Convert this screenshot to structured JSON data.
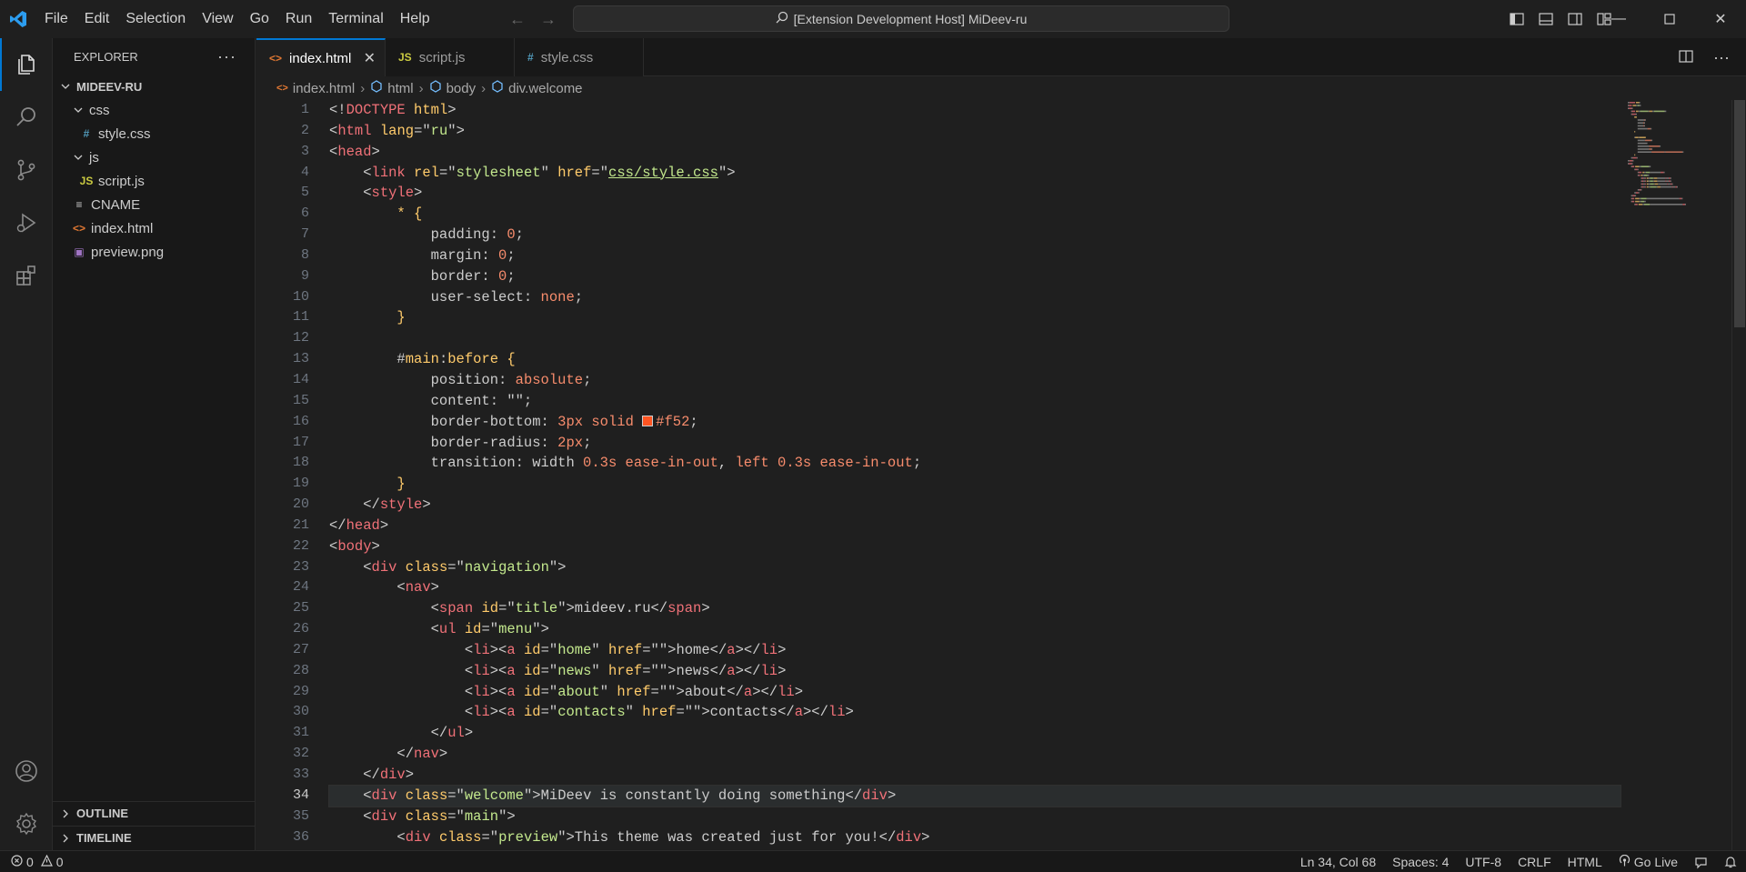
{
  "titlebar": {
    "menu": [
      "File",
      "Edit",
      "Selection",
      "View",
      "Go",
      "Run",
      "Terminal",
      "Help"
    ],
    "command_center": "[Extension Development Host] MiDeev-ru"
  },
  "sidebar": {
    "title": "EXPLORER",
    "root": "MIDEEV-RU",
    "tree": [
      {
        "label": "css",
        "type": "folder",
        "depth": 1
      },
      {
        "label": "style.css",
        "type": "css",
        "depth": 2
      },
      {
        "label": "js",
        "type": "folder",
        "depth": 1
      },
      {
        "label": "script.js",
        "type": "js",
        "depth": 2
      },
      {
        "label": "CNAME",
        "type": "text",
        "depth": 1
      },
      {
        "label": "index.html",
        "type": "html",
        "depth": 1
      },
      {
        "label": "preview.png",
        "type": "image",
        "depth": 1
      }
    ],
    "outline": "OUTLINE",
    "timeline": "TIMELINE"
  },
  "tabs": [
    {
      "label": "index.html",
      "icon": "html",
      "active": true
    },
    {
      "label": "script.js",
      "icon": "js",
      "active": false
    },
    {
      "label": "style.css",
      "icon": "css",
      "active": false
    }
  ],
  "breadcrumbs": [
    "index.html",
    "html",
    "body",
    "div.welcome"
  ],
  "editor": {
    "current_line": 34,
    "lines": [
      [
        [
          "p",
          "<!"
        ],
        [
          "tag",
          "DOCTYPE"
        ],
        [
          "p",
          " "
        ],
        [
          "attr",
          "html"
        ],
        [
          "p",
          ">"
        ]
      ],
      [
        [
          "p",
          "<"
        ],
        [
          "tag",
          "html"
        ],
        [
          "p",
          " "
        ],
        [
          "attr",
          "lang"
        ],
        [
          "p",
          "=\""
        ],
        [
          "str",
          "ru"
        ],
        [
          "p",
          "\">"
        ]
      ],
      [
        [
          "p",
          "<"
        ],
        [
          "tag",
          "head"
        ],
        [
          "p",
          ">"
        ]
      ],
      [
        [
          "p",
          "    <"
        ],
        [
          "tag",
          "link"
        ],
        [
          "p",
          " "
        ],
        [
          "attr",
          "rel"
        ],
        [
          "p",
          "=\""
        ],
        [
          "str",
          "stylesheet"
        ],
        [
          "p",
          "\" "
        ],
        [
          "attr",
          "href"
        ],
        [
          "p",
          "=\""
        ],
        [
          "link",
          "css/style.css"
        ],
        [
          "p",
          "\">"
        ]
      ],
      [
        [
          "p",
          "    <"
        ],
        [
          "tag",
          "style"
        ],
        [
          "p",
          ">"
        ]
      ],
      [
        [
          "p",
          "        "
        ],
        [
          "sel",
          "* {"
        ]
      ],
      [
        [
          "p",
          "            padding: "
        ],
        [
          "num",
          "0"
        ],
        [
          "p",
          ";"
        ]
      ],
      [
        [
          "p",
          "            margin: "
        ],
        [
          "num",
          "0"
        ],
        [
          "p",
          ";"
        ]
      ],
      [
        [
          "p",
          "            border: "
        ],
        [
          "num",
          "0"
        ],
        [
          "p",
          ";"
        ]
      ],
      [
        [
          "p",
          "            user-select: "
        ],
        [
          "num",
          "none"
        ],
        [
          "p",
          ";"
        ]
      ],
      [
        [
          "p",
          "        "
        ],
        [
          "sel",
          "}"
        ]
      ],
      [
        [
          "p",
          ""
        ]
      ],
      [
        [
          "p",
          "        #"
        ],
        [
          "sel",
          "main"
        ],
        [
          "p",
          ":"
        ],
        [
          "sel",
          "before {"
        ]
      ],
      [
        [
          "p",
          "            position: "
        ],
        [
          "num",
          "absolute"
        ],
        [
          "p",
          ";"
        ]
      ],
      [
        [
          "p",
          "            content: \"\";"
        ]
      ],
      [
        [
          "p",
          "            border-bottom: "
        ],
        [
          "num",
          "3px solid "
        ],
        [
          "swatch",
          "#f52"
        ],
        [
          "p",
          ";"
        ]
      ],
      [
        [
          "p",
          "            border-radius: "
        ],
        [
          "num",
          "2px"
        ],
        [
          "p",
          ";"
        ]
      ],
      [
        [
          "p",
          "            transition: width "
        ],
        [
          "num",
          "0.3s ease-in-out"
        ],
        [
          "p",
          ", "
        ],
        [
          "num",
          "left 0.3s ease-in-out"
        ],
        [
          "p",
          ";"
        ]
      ],
      [
        [
          "p",
          "        "
        ],
        [
          "sel",
          "}"
        ]
      ],
      [
        [
          "p",
          "    </"
        ],
        [
          "tag",
          "style"
        ],
        [
          "p",
          ">"
        ]
      ],
      [
        [
          "p",
          "</"
        ],
        [
          "tag",
          "head"
        ],
        [
          "p",
          ">"
        ]
      ],
      [
        [
          "p",
          "<"
        ],
        [
          "tag",
          "body"
        ],
        [
          "p",
          ">"
        ]
      ],
      [
        [
          "p",
          "    <"
        ],
        [
          "tag",
          "div"
        ],
        [
          "p",
          " "
        ],
        [
          "attr",
          "class"
        ],
        [
          "p",
          "=\""
        ],
        [
          "str",
          "navigation"
        ],
        [
          "p",
          "\">"
        ]
      ],
      [
        [
          "p",
          "        <"
        ],
        [
          "tag",
          "nav"
        ],
        [
          "p",
          ">"
        ]
      ],
      [
        [
          "p",
          "            <"
        ],
        [
          "tag",
          "span"
        ],
        [
          "p",
          " "
        ],
        [
          "attr",
          "id"
        ],
        [
          "p",
          "=\""
        ],
        [
          "str",
          "title"
        ],
        [
          "p",
          "\">mideev.ru</"
        ],
        [
          "tag",
          "span"
        ],
        [
          "p",
          ">"
        ]
      ],
      [
        [
          "p",
          "            <"
        ],
        [
          "tag",
          "ul"
        ],
        [
          "p",
          " "
        ],
        [
          "attr",
          "id"
        ],
        [
          "p",
          "=\""
        ],
        [
          "str",
          "menu"
        ],
        [
          "p",
          "\">"
        ]
      ],
      [
        [
          "p",
          "                <"
        ],
        [
          "tag",
          "li"
        ],
        [
          "p",
          "><"
        ],
        [
          "tag",
          "a"
        ],
        [
          "p",
          " "
        ],
        [
          "attr",
          "id"
        ],
        [
          "p",
          "=\""
        ],
        [
          "str",
          "home"
        ],
        [
          "p",
          "\" "
        ],
        [
          "attr",
          "href"
        ],
        [
          "p",
          "=\"\">home</"
        ],
        [
          "tag",
          "a"
        ],
        [
          "p",
          "></"
        ],
        [
          "tag",
          "li"
        ],
        [
          "p",
          ">"
        ]
      ],
      [
        [
          "p",
          "                <"
        ],
        [
          "tag",
          "li"
        ],
        [
          "p",
          "><"
        ],
        [
          "tag",
          "a"
        ],
        [
          "p",
          " "
        ],
        [
          "attr",
          "id"
        ],
        [
          "p",
          "=\""
        ],
        [
          "str",
          "news"
        ],
        [
          "p",
          "\" "
        ],
        [
          "attr",
          "href"
        ],
        [
          "p",
          "=\"\">news</"
        ],
        [
          "tag",
          "a"
        ],
        [
          "p",
          "></"
        ],
        [
          "tag",
          "li"
        ],
        [
          "p",
          ">"
        ]
      ],
      [
        [
          "p",
          "                <"
        ],
        [
          "tag",
          "li"
        ],
        [
          "p",
          "><"
        ],
        [
          "tag",
          "a"
        ],
        [
          "p",
          " "
        ],
        [
          "attr",
          "id"
        ],
        [
          "p",
          "=\""
        ],
        [
          "str",
          "about"
        ],
        [
          "p",
          "\" "
        ],
        [
          "attr",
          "href"
        ],
        [
          "p",
          "=\"\">about</"
        ],
        [
          "tag",
          "a"
        ],
        [
          "p",
          "></"
        ],
        [
          "tag",
          "li"
        ],
        [
          "p",
          ">"
        ]
      ],
      [
        [
          "p",
          "                <"
        ],
        [
          "tag",
          "li"
        ],
        [
          "p",
          "><"
        ],
        [
          "tag",
          "a"
        ],
        [
          "p",
          " "
        ],
        [
          "attr",
          "id"
        ],
        [
          "p",
          "=\""
        ],
        [
          "str",
          "contacts"
        ],
        [
          "p",
          "\" "
        ],
        [
          "attr",
          "href"
        ],
        [
          "p",
          "=\"\">contacts</"
        ],
        [
          "tag",
          "a"
        ],
        [
          "p",
          "></"
        ],
        [
          "tag",
          "li"
        ],
        [
          "p",
          ">"
        ]
      ],
      [
        [
          "p",
          "            </"
        ],
        [
          "tag",
          "ul"
        ],
        [
          "p",
          ">"
        ]
      ],
      [
        [
          "p",
          "        </"
        ],
        [
          "tag",
          "nav"
        ],
        [
          "p",
          ">"
        ]
      ],
      [
        [
          "p",
          "    </"
        ],
        [
          "tag",
          "div"
        ],
        [
          "p",
          ">"
        ]
      ],
      [
        [
          "p",
          "    <"
        ],
        [
          "tag",
          "div"
        ],
        [
          "p",
          " "
        ],
        [
          "attr",
          "class"
        ],
        [
          "p",
          "=\""
        ],
        [
          "str",
          "welcome"
        ],
        [
          "p",
          "\">MiDeev is constantly doing something</"
        ],
        [
          "tag",
          "div"
        ],
        [
          "p",
          ">"
        ]
      ],
      [
        [
          "p",
          "    <"
        ],
        [
          "tag",
          "div"
        ],
        [
          "p",
          " "
        ],
        [
          "attr",
          "class"
        ],
        [
          "p",
          "=\""
        ],
        [
          "str",
          "main"
        ],
        [
          "p",
          "\">"
        ]
      ],
      [
        [
          "p",
          "        <"
        ],
        [
          "tag",
          "div"
        ],
        [
          "p",
          " "
        ],
        [
          "attr",
          "class"
        ],
        [
          "p",
          "=\""
        ],
        [
          "str",
          "preview"
        ],
        [
          "p",
          "\">This theme was created just for you!</"
        ],
        [
          "tag",
          "div"
        ],
        [
          "p",
          ">"
        ]
      ]
    ]
  },
  "status": {
    "errors": "0",
    "warnings": "0",
    "position": "Ln 34, Col 68",
    "spaces": "Spaces: 4",
    "encoding": "UTF-8",
    "eol": "CRLF",
    "language": "HTML",
    "go_live": "Go Live"
  },
  "colors": {
    "accent": "#0078d4",
    "swatch": "#ff5522"
  }
}
